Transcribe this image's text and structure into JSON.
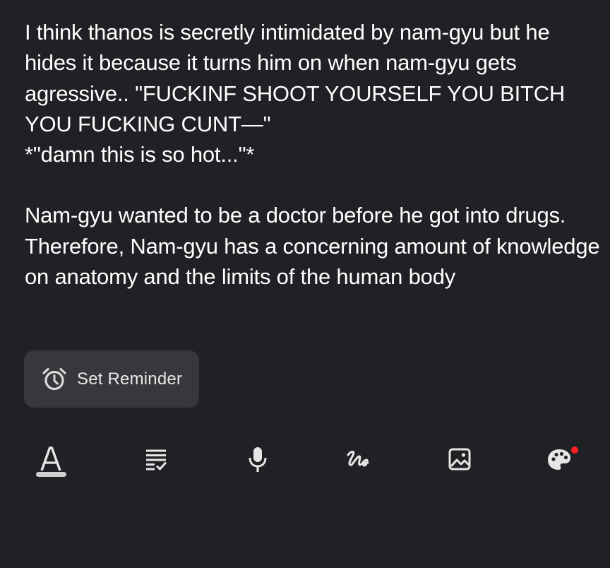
{
  "note": {
    "paragraphs": [
      "I think thanos is secretly intimidated by nam-gyu but he hides it because it turns him on when nam-gyu gets agressive.. \"FUCKINF SHOOT YOURSELF YOU BITCH YOU FUCKING CUNT—\"\n*\"damn this is so hot...\"*",
      "Nam-gyu wanted to be a doctor before he got into drugs. Therefore, Nam-gyu has a concerning amount of knowledge on anatomy and the limits of the human body"
    ]
  },
  "reminder": {
    "label": "Set Reminder",
    "icon": "alarm-clock-icon"
  },
  "toolbar": {
    "items": [
      {
        "name": "text-format",
        "icon": "text-format-icon",
        "selected": true
      },
      {
        "name": "checklist",
        "icon": "checklist-icon"
      },
      {
        "name": "voice-recording",
        "icon": "microphone-icon"
      },
      {
        "name": "handwriting",
        "icon": "handwriting-icon"
      },
      {
        "name": "image",
        "icon": "image-icon"
      },
      {
        "name": "theme",
        "icon": "palette-icon",
        "badge": true
      }
    ]
  },
  "colors": {
    "background": "#202124",
    "text": "#ffffff",
    "chip_background": "#37383b",
    "icon": "#e6e6e6",
    "badge": "#ff1f1f"
  }
}
